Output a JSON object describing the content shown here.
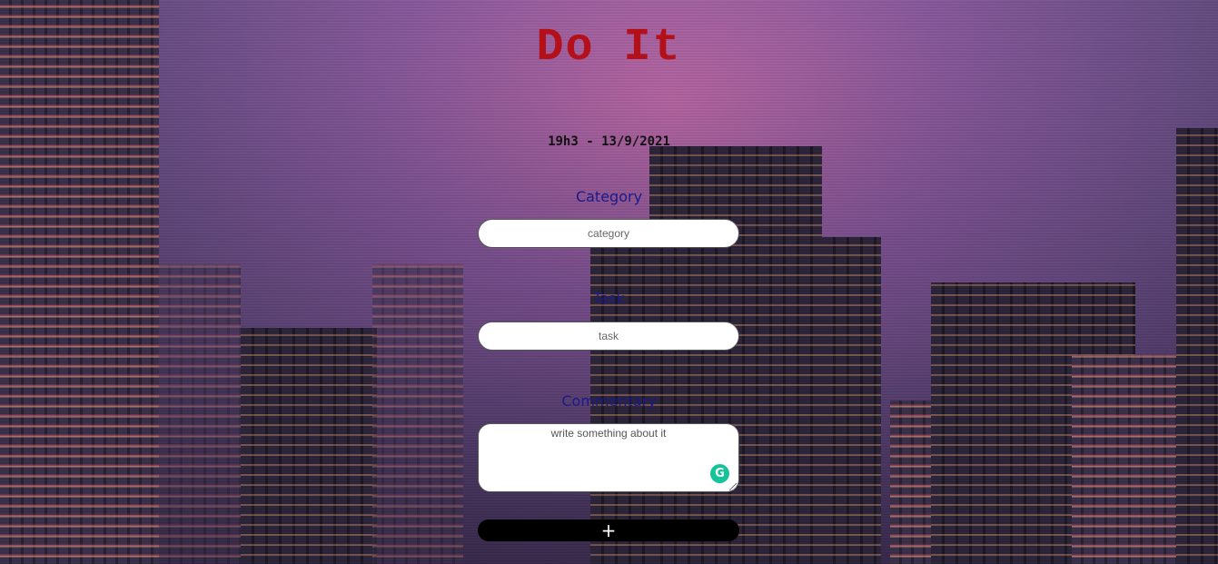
{
  "app": {
    "title": "Do It",
    "datetime": "19h3 - 13/9/2021"
  },
  "form": {
    "category": {
      "label": "Category",
      "placeholder": "category"
    },
    "task": {
      "label": "Task",
      "placeholder": "task"
    },
    "commentary": {
      "label": "Commentary",
      "placeholder": "write something about it"
    },
    "add_button": {
      "label": "+"
    }
  },
  "extension": {
    "icon": "grammarly-icon",
    "glyph": "G"
  },
  "colors": {
    "title": "#b3101a",
    "labels": "#1a1a8a",
    "button": "#000000",
    "grammarly": "#15c39a"
  }
}
